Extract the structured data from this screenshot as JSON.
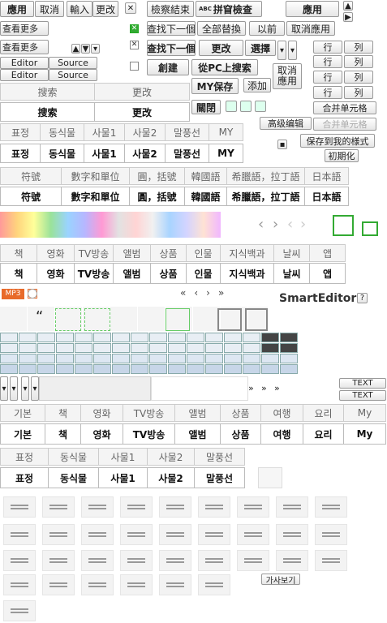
{
  "toolbar1": {
    "apply": "應用",
    "cancel": "取消",
    "input": "輸入",
    "change": "更改"
  },
  "see_more": [
    "查看更多",
    "查看更多"
  ],
  "editor_tabs": [
    "Editor",
    "Source",
    "Editor",
    "Source"
  ],
  "search_header": [
    "搜索",
    "更改"
  ],
  "search_bold": [
    "搜索",
    "更改"
  ],
  "korean_tabs": [
    "표정",
    "동식물",
    "사물1",
    "사물2",
    "말풍선",
    "MY"
  ],
  "chinese_tabs": [
    "符號",
    "數字和單位",
    "圓，括號",
    "韓國語",
    "希臘語，拉丁語",
    "日本語"
  ],
  "korean_cats": [
    "책",
    "영화",
    "TV방송",
    "앨범",
    "상품",
    "인물",
    "지식백과",
    "날씨",
    "앱"
  ],
  "cats2": [
    "기본",
    "책",
    "영화",
    "TV방송",
    "앨범",
    "상품",
    "여행",
    "요리",
    "My"
  ],
  "korean_tabs2": [
    "표정",
    "동식물",
    "사물1",
    "사물2",
    "말풍선"
  ],
  "spell": {
    "end": "檢察結束",
    "check": "拼窅檢查",
    "apply": "應用",
    "abc": "ABC"
  },
  "find": {
    "next": "查找下一個",
    "replace_all": "全部替換",
    "prev": "以前",
    "cancel_apply": "取消應用",
    "next2": "查找下一個",
    "change": "更改",
    "select": "選擇"
  },
  "create": "創建",
  "from_pc": "從PC上搜索",
  "cancel_apply2": [
    "取消",
    "應用"
  ],
  "my_save": "MY保存",
  "add": "添加",
  "close": "關閉",
  "table": {
    "row": "行",
    "col": "列",
    "merge": "合并单元格",
    "merge2": "合并单元格",
    "advanced": "高级编辑",
    "save_style": "保存到我的様式",
    "init": "初期化"
  },
  "smart_editor": "SmartEditor",
  "tm": "™",
  "help": "?",
  "mp3": "MP3",
  "text_labels": [
    "TEXT",
    "TEXT"
  ],
  "preview": "가사보기",
  "nav_glyphs": [
    "«",
    "‹",
    "›",
    "»"
  ],
  "arrow_glyphs": [
    "‹",
    "›",
    "‹",
    "›"
  ],
  "quote": "“",
  "arrows": {
    "up": "▲",
    "down": "▼",
    "left": "◀",
    "right": "▶",
    "caret": "▾",
    "double": "»"
  },
  "check_glyph": "✕",
  "square_glyph": "▪",
  "colors": {
    "green": "#33aa33",
    "orange": "#e86a2a",
    "border": "#999999"
  }
}
